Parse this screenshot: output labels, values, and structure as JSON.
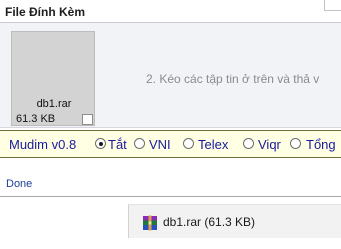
{
  "attachment_panel": {
    "title": "File Đính Kèm",
    "file": {
      "name": "db1.rar",
      "size": "61.3 KB"
    },
    "hint": "2. Kéo các tập tin ở trên và thả v"
  },
  "mudim": {
    "label": "Mudim v0.8",
    "options": [
      "Tắt",
      "VNI",
      "Telex",
      "Viqr",
      "Tổng"
    ],
    "selected": "Tắt"
  },
  "status_bar": {
    "text": "Done"
  },
  "download": {
    "label": "db1.rar (61.3 KB)",
    "icon": "winrar-archive-icon"
  },
  "colors": {
    "mudim_text": "#1a1a9e",
    "mudim_bg": "#ffffe4",
    "status_text": "#1c3f9c"
  }
}
